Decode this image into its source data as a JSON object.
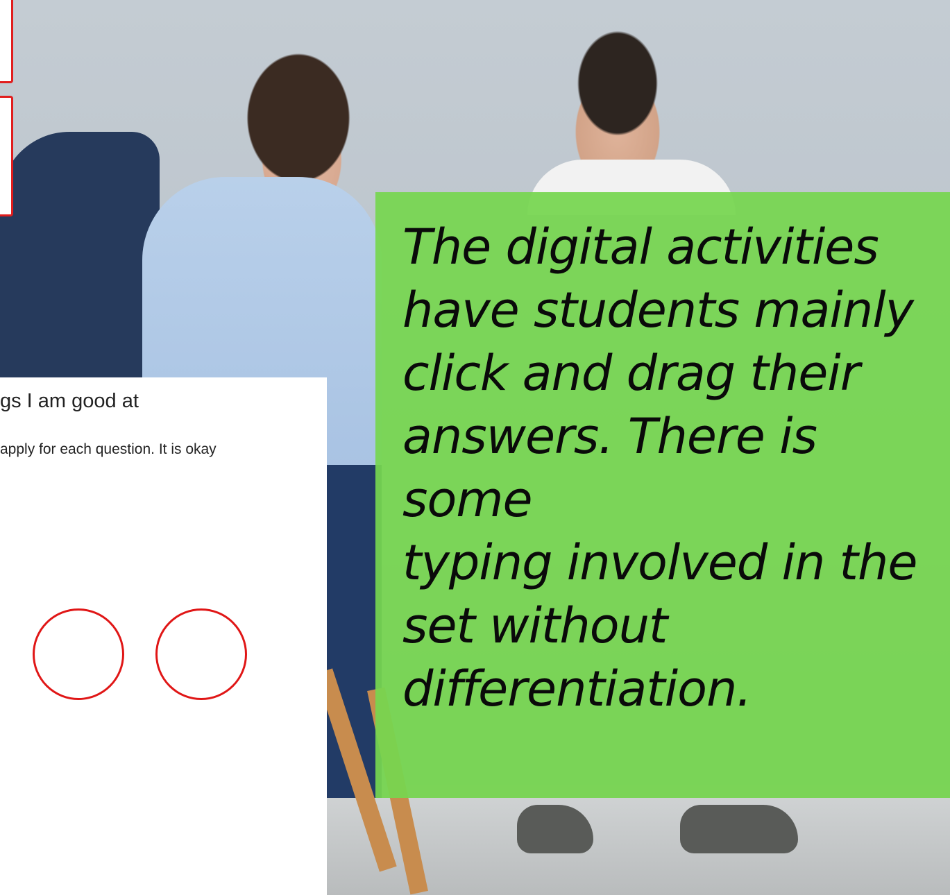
{
  "worksheet": {
    "title": "gs I am good at",
    "instruction": "apply  for each question.  It is okay"
  },
  "callout": {
    "text": "The digital activities\nhave students mainly\nclick and drag their\nanswers. There is some\ntyping involved in the\nset without\ndifferentiation."
  },
  "colors": {
    "callout_background": "#76d650",
    "worksheet_circle": "#e01616",
    "worksheet_frame": "#e11d1d"
  }
}
